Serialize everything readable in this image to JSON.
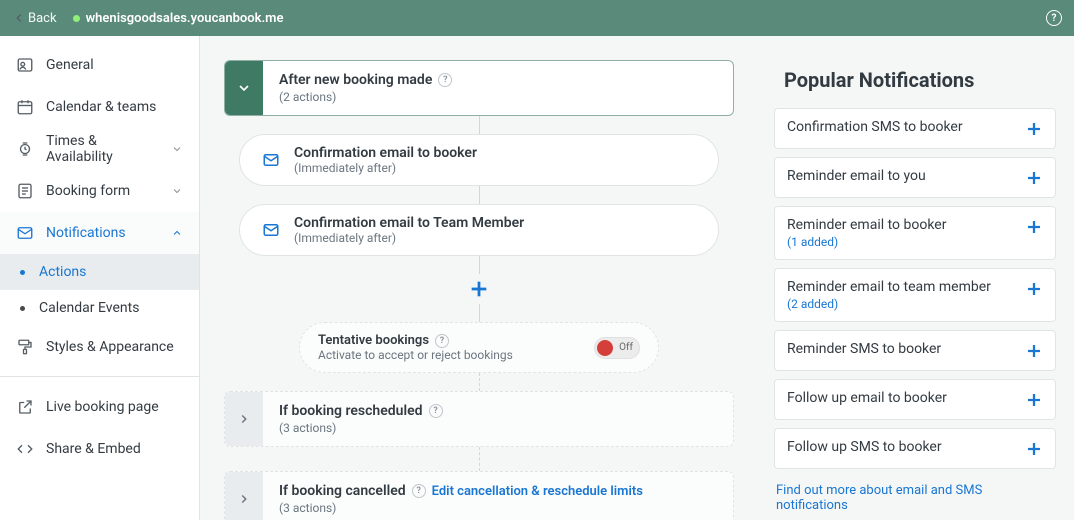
{
  "header": {
    "back_label": "Back",
    "url": "whenisgoodsales.youcanbook.me"
  },
  "sidebar": {
    "items": [
      {
        "label": "General"
      },
      {
        "label": "Calendar & teams"
      },
      {
        "label": "Times & Availability"
      },
      {
        "label": "Booking form"
      },
      {
        "label": "Notifications"
      }
    ],
    "sub_items": [
      {
        "label": "Actions"
      },
      {
        "label": "Calendar Events"
      }
    ],
    "items2": [
      {
        "label": "Styles & Appearance"
      }
    ],
    "items3": [
      {
        "label": "Live booking page"
      },
      {
        "label": "Share & Embed"
      }
    ]
  },
  "flow": {
    "section1": {
      "title": "After new booking made",
      "sub": "(2 actions)"
    },
    "action1": {
      "title": "Confirmation email to booker",
      "sub": "(Immediately after)"
    },
    "action2": {
      "title": "Confirmation email to Team Member",
      "sub": "(Immediately after)"
    },
    "tentative": {
      "title": "Tentative bookings",
      "sub": "Activate to accept or reject bookings",
      "toggle": "Off"
    },
    "section2": {
      "title": "If booking rescheduled",
      "sub": "(3 actions)"
    },
    "section3": {
      "title": "If booking cancelled",
      "sub": "(3 actions)",
      "link": "Edit cancellation & reschedule limits"
    }
  },
  "popular": {
    "title": "Popular Notifications",
    "items": [
      {
        "name": "Confirmation SMS to booker"
      },
      {
        "name": "Reminder email to you"
      },
      {
        "name": "Reminder email to booker",
        "added": "(1 added)"
      },
      {
        "name": "Reminder email to team member",
        "added": "(2 added)"
      },
      {
        "name": "Reminder SMS to booker"
      },
      {
        "name": "Follow up email to booker"
      },
      {
        "name": "Follow up SMS to booker"
      }
    ],
    "footer": "Find out more about email and SMS notifications"
  }
}
